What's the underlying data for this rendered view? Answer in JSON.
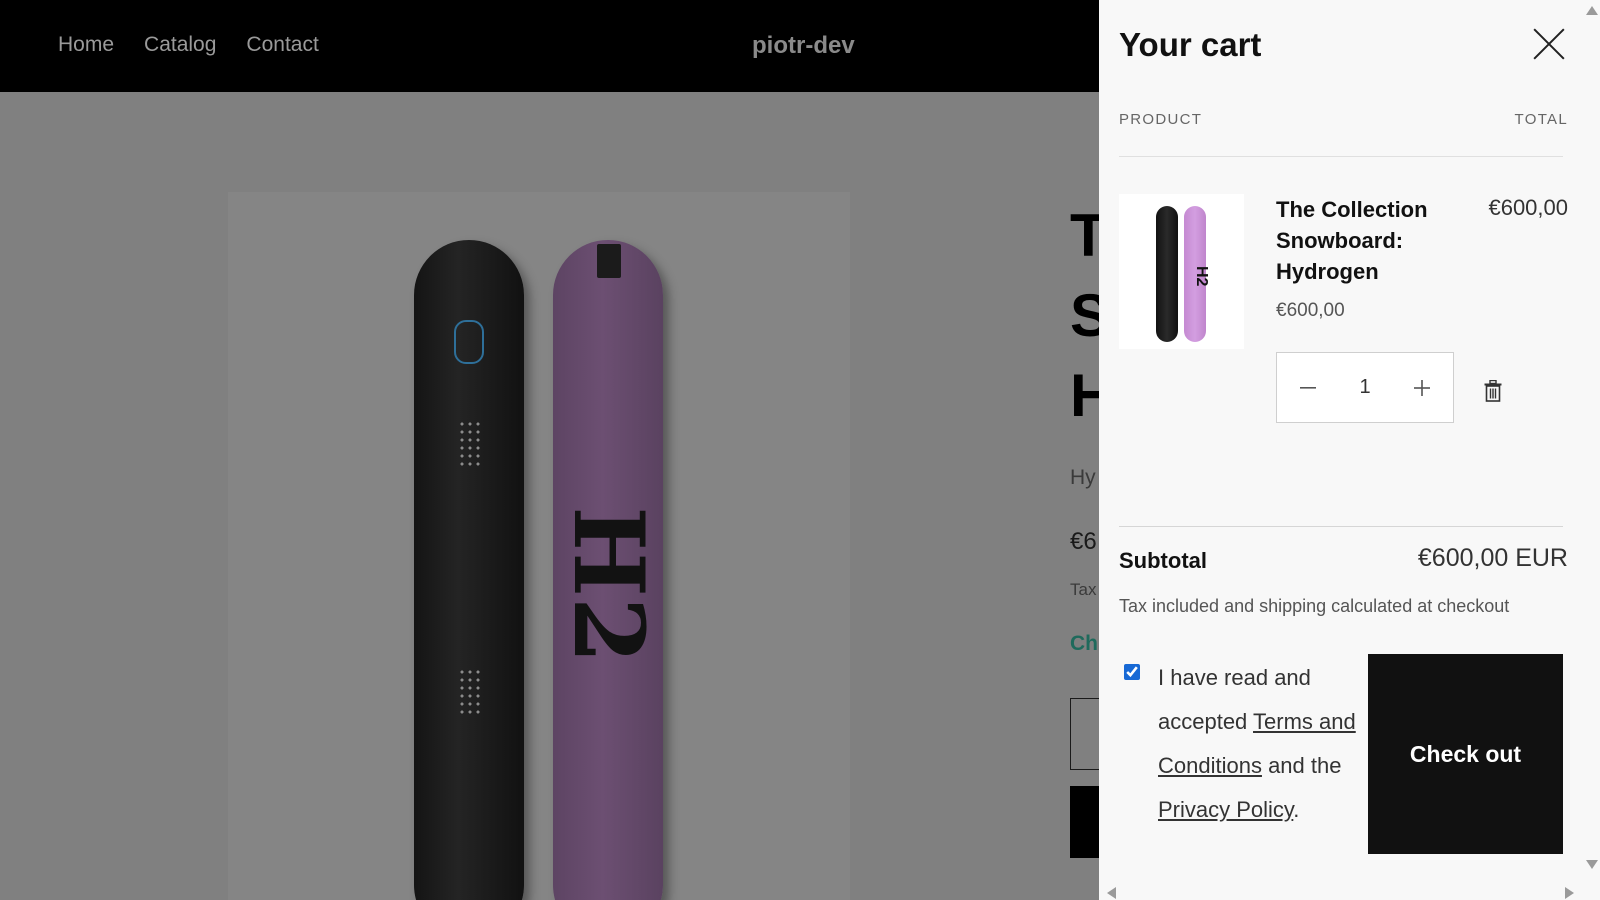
{
  "header": {
    "nav": [
      {
        "label": "Home"
      },
      {
        "label": "Catalog"
      },
      {
        "label": "Contact"
      }
    ],
    "brand": "piotr-dev"
  },
  "product_page": {
    "title_visible": "T\nS\nH",
    "vendor_visible": "Hy",
    "price_visible": "€6",
    "tax_visible": "Tax",
    "shipping_visible": "Ch"
  },
  "cart": {
    "title": "Your cart",
    "columns": {
      "product": "PRODUCT",
      "total": "TOTAL"
    },
    "items": [
      {
        "name": "The Collection Snowboard: Hydrogen",
        "unit_price": "€600,00",
        "line_total": "€600,00",
        "quantity": "1",
        "thumb_text": "H2"
      }
    ],
    "subtotal_label": "Subtotal",
    "subtotal_value": "€600,00 EUR",
    "tax_note": "Tax included and shipping calculated at checkout",
    "terms": {
      "prefix": "I have read and accepted ",
      "terms_link": "Terms and Conditions",
      "middle": " and the ",
      "privacy_link": "Privacy Policy",
      "suffix": ".",
      "checked": true
    },
    "checkout_label": "Check out"
  },
  "colors": {
    "overlay": "#808080",
    "drawer_bg": "#f8f8f8",
    "checkout_bg": "#111111",
    "accent_checkbox": "#1769d5",
    "shipping_link": "#1f6a5c"
  },
  "icons": {
    "close": "close-icon",
    "minus": "minus-icon",
    "plus": "plus-icon",
    "delete": "trash-icon"
  }
}
